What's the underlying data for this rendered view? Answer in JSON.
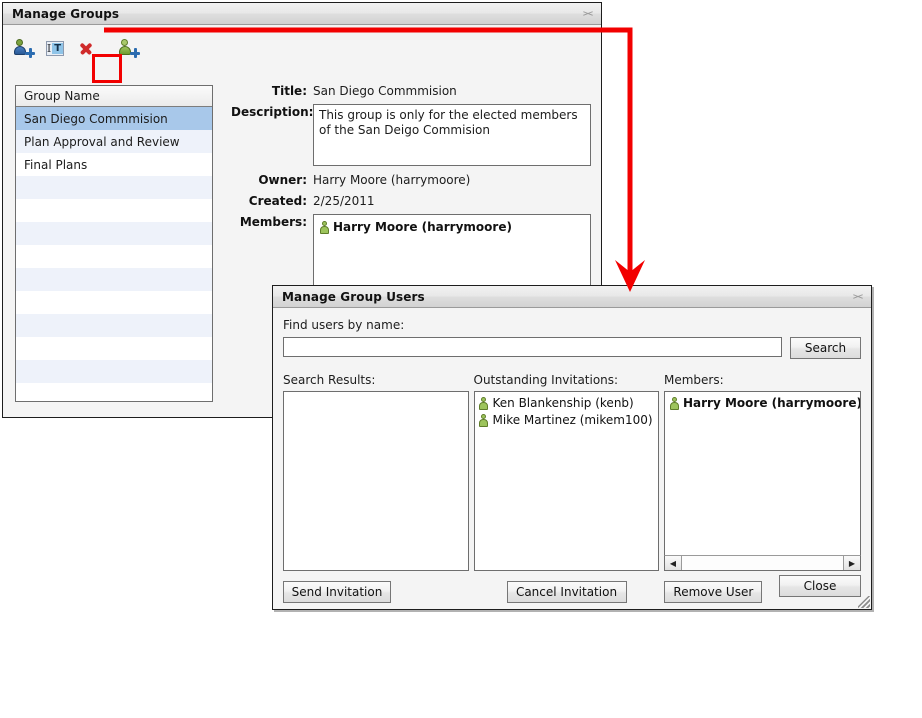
{
  "manage_groups": {
    "title": "Manage Groups",
    "collapse_icon": "collapse-chevron-icon",
    "toolbar": [
      {
        "name": "add-group",
        "icon": "user-add-blue-icon",
        "highlighted": false
      },
      {
        "name": "rename-group",
        "icon": "rename-textbox-icon",
        "highlighted": false
      },
      {
        "name": "delete-group",
        "icon": "red-x-delete-icon",
        "highlighted": false
      },
      {
        "name": "add-user",
        "icon": "user-add-green-icon",
        "highlighted": true
      }
    ],
    "group_list": {
      "header": "Group Name",
      "rows": [
        {
          "label": "San Diego Commmision",
          "selected": true
        },
        {
          "label": "Plan Approval and Review",
          "selected": false
        },
        {
          "label": "Final Plans",
          "selected": false
        }
      ],
      "empty_row_count": 11
    },
    "detail": {
      "title_label": "Title:",
      "title_value": "San Diego Commmision",
      "description_label": "Description:",
      "description_value": "This group is only for the elected members of the San Deigo Commision",
      "owner_label": "Owner:",
      "owner_value": "Harry Moore (harrymoore)",
      "created_label": "Created:",
      "created_value": "2/25/2011",
      "members_label": "Members:",
      "members": [
        {
          "label": "Harry Moore (harrymoore)",
          "icon": "person-green-icon"
        }
      ]
    }
  },
  "manage_group_users": {
    "title": "Manage Group Users",
    "collapse_icon": "collapse-chevron-icon",
    "find_label": "Find users by name:",
    "search_value": "",
    "search_placeholder": "",
    "search_button": "Search",
    "search_results": {
      "label": "Search Results:",
      "items": []
    },
    "outstanding_invitations": {
      "label": "Outstanding Invitations:",
      "items": [
        {
          "label": "Ken Blankenship (kenb)",
          "icon": "person-green-icon"
        },
        {
          "label": "Mike Martinez (mikem100)",
          "icon": "person-green-icon"
        }
      ]
    },
    "members": {
      "label": "Members:",
      "items": [
        {
          "label": "Harry Moore (harrymoore)",
          "icon": "person-green-icon"
        }
      ],
      "scroll_left_icon": "triangle-left-icon",
      "scroll_right_icon": "triangle-right-icon"
    },
    "buttons": {
      "send_invitation": "Send Invitation",
      "cancel_invitation": "Cancel Invitation",
      "remove_user": "Remove User",
      "close": "Close"
    },
    "resize_grip_icon": "resize-grip-icon"
  },
  "annotation": {
    "color": "#f20000",
    "description": "red arrow from add-user toolbar button to Manage Group Users dialog"
  }
}
